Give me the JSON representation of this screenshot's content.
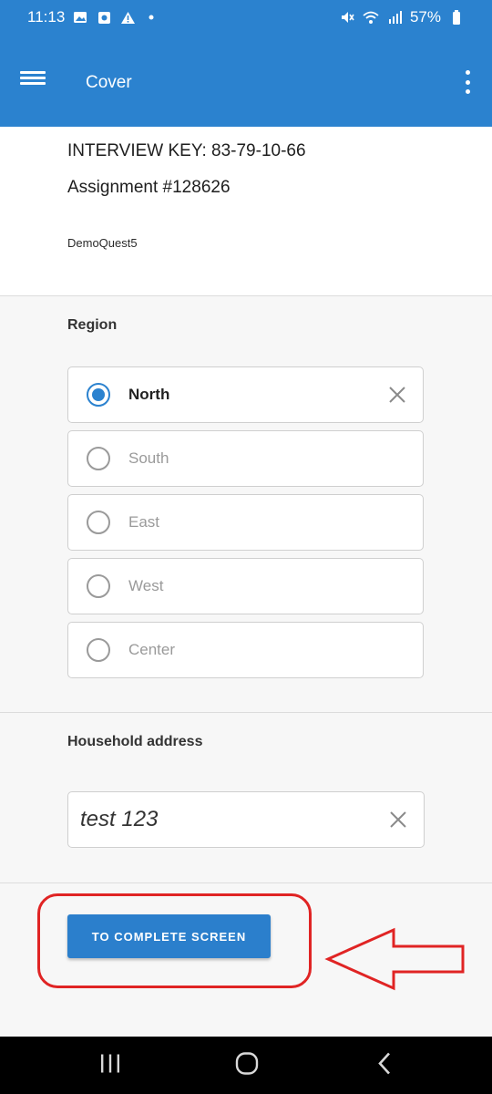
{
  "status_bar": {
    "time": "11:13",
    "battery": "57%",
    "left_icons": [
      "image-icon",
      "app-icon",
      "warning-icon",
      "dot-icon"
    ],
    "right_icons": [
      "mute-icon",
      "wifi-icon",
      "signal-icon",
      "battery-icon"
    ]
  },
  "app_bar": {
    "title": "Cover"
  },
  "cover": {
    "interview_key": "INTERVIEW KEY: 83-79-10-66",
    "assignment": "Assignment #128626",
    "questionnaire": "DemoQuest5"
  },
  "region": {
    "title": "Region",
    "options": [
      {
        "label": "North",
        "selected": true
      },
      {
        "label": "South",
        "selected": false
      },
      {
        "label": "East",
        "selected": false
      },
      {
        "label": "West",
        "selected": false
      },
      {
        "label": "Center",
        "selected": false
      }
    ]
  },
  "address": {
    "title": "Household address",
    "value": "test 123"
  },
  "actions": {
    "complete_label": "TO COMPLETE SCREEN"
  },
  "colors": {
    "accent": "#2b82cf",
    "annotation": "#e02424"
  }
}
